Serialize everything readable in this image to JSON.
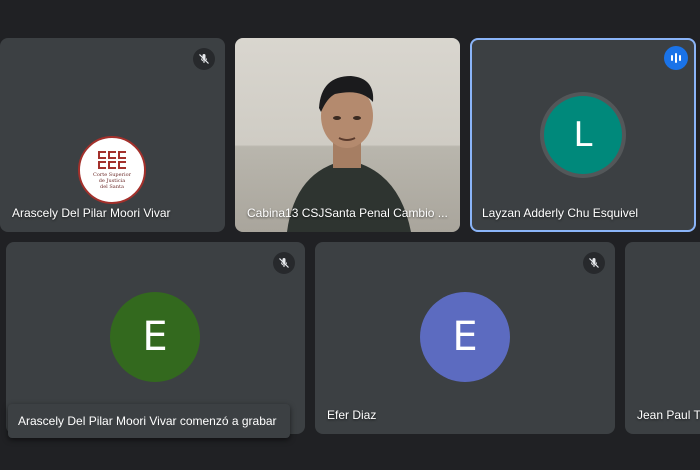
{
  "tiles": [
    {
      "name": "Arascely Del Pilar Moori Vivar",
      "muted": true,
      "avatar_type": "logo",
      "logo_text": [
        "Corte Superior",
        "de Justicia",
        "del Santa"
      ]
    },
    {
      "name": "Cabina13 CSJSanta Penal Cambio ...",
      "muted": false,
      "avatar_type": "video"
    },
    {
      "name": "Layzan Adderly Chu Esquivel",
      "speaking": true,
      "avatar_letter": "L",
      "avatar_color": "#00897b"
    },
    {
      "name": "",
      "muted": true,
      "avatar_letter": "E",
      "avatar_color": "#33691e"
    },
    {
      "name": "Efer Diaz",
      "muted": true,
      "avatar_letter": "E",
      "avatar_color": "#5c6bc0"
    },
    {
      "name": "Jean Paul T"
    }
  ],
  "notification": {
    "text": "Arascely Del Pilar Moori Vivar comenzó a grabar"
  },
  "colors": {
    "background": "#202124",
    "tile": "#3c4043",
    "active_border": "#8ab4f8",
    "speaking": "#1a73e8"
  },
  "icons": {
    "muted": "mic-off-icon",
    "speaking": "audio-bars-icon"
  }
}
